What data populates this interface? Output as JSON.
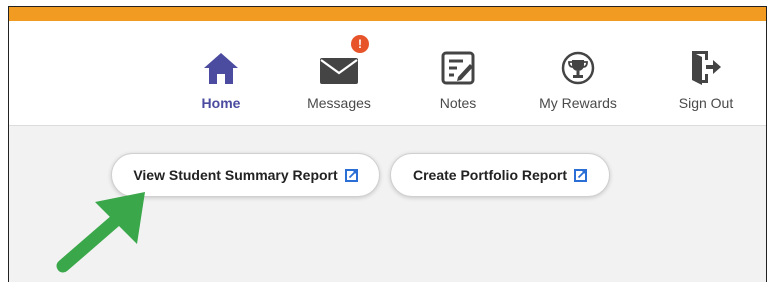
{
  "nav": {
    "items": [
      {
        "label": "Home",
        "icon": "home-icon",
        "active": true
      },
      {
        "label": "Messages",
        "icon": "envelope-icon",
        "badge": "!"
      },
      {
        "label": "Notes",
        "icon": "notes-icon"
      },
      {
        "label": "My Rewards",
        "icon": "trophy-icon"
      },
      {
        "label": "Sign Out",
        "icon": "sign-out-icon"
      }
    ]
  },
  "reports": {
    "student_summary_label": "View Student Summary Report",
    "portfolio_label": "Create Portfolio Report"
  },
  "colors": {
    "accent": "#f29b23",
    "active_nav": "#4b4ba0",
    "badge": "#e8542a",
    "link_icon": "#2b6fd6",
    "pointer_arrow": "#3aa84a"
  }
}
